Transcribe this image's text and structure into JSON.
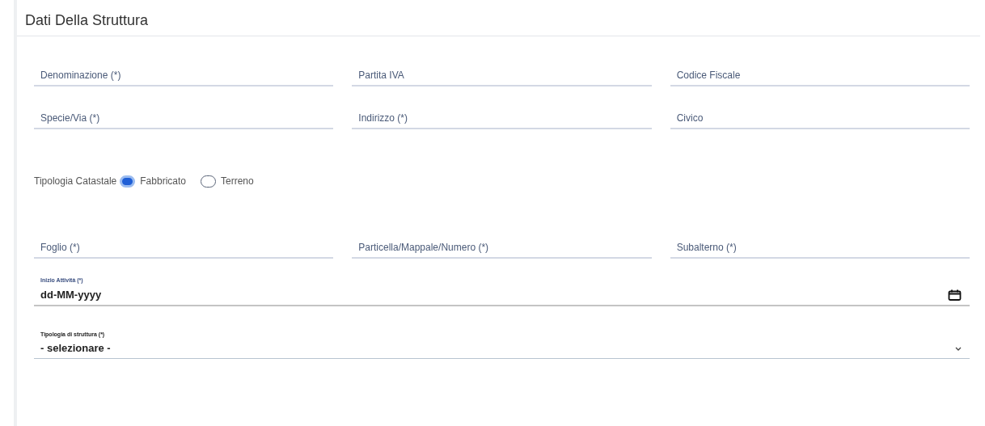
{
  "section": {
    "title": "Dati Della Struttura"
  },
  "rows": [
    [
      {
        "placeholder": "Denominazione (*)"
      },
      {
        "placeholder": "Partita IVA"
      },
      {
        "placeholder": "Codice Fiscale"
      }
    ],
    [
      {
        "placeholder": "Specie/Via (*)"
      },
      {
        "placeholder": "Indirizzo (*)"
      },
      {
        "placeholder": "Civico"
      }
    ]
  ],
  "radio_group": {
    "label": "Tipologia Catastale",
    "options": [
      {
        "label": "Fabbricato",
        "selected": true
      },
      {
        "label": "Terreno",
        "selected": false
      }
    ]
  },
  "rows_2": [
    [
      {
        "placeholder": "Foglio (*)"
      },
      {
        "placeholder": "Particella/Mappale/Numero (*)"
      },
      {
        "placeholder": "Subalterno (*)"
      }
    ]
  ],
  "date_field": {
    "label": "Inizio Attività (*)",
    "value": "dd-MM-yyyy"
  },
  "select_field": {
    "label": "Tipologia di struttura (*)",
    "value": "- selezionare -"
  }
}
